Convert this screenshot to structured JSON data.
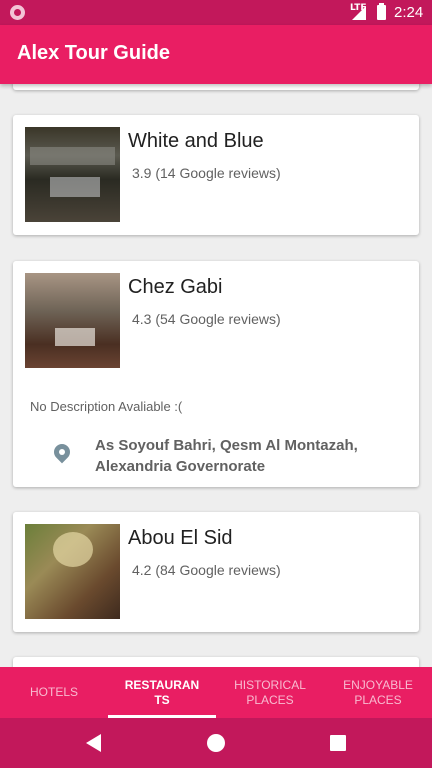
{
  "status": {
    "network": "LTE",
    "time": "2:24"
  },
  "app": {
    "title": "Alex Tour Guide"
  },
  "restaurants": [
    {
      "name": "White and Blue",
      "rating": "3.9 (14 Google reviews)"
    },
    {
      "name": "Chez Gabi",
      "rating": "4.3 (54 Google reviews)",
      "description": "No Description Avaliable :(",
      "address": "As Soyouf Bahri, Qesm Al Montazah, Alexandria Governorate"
    },
    {
      "name": "Abou El Sid",
      "rating": "4.2 (84 Google reviews)"
    }
  ],
  "tabs": [
    {
      "label": "HOTELS",
      "active": false
    },
    {
      "label": "RESTAURAN\nTS",
      "active": true
    },
    {
      "label": "HISTORICAL\nPLACES",
      "active": false
    },
    {
      "label": "ENJOYABLE\nPLACES",
      "active": false
    }
  ],
  "colors": {
    "primary": "#e91e63",
    "primary_dark": "#c2185b"
  }
}
